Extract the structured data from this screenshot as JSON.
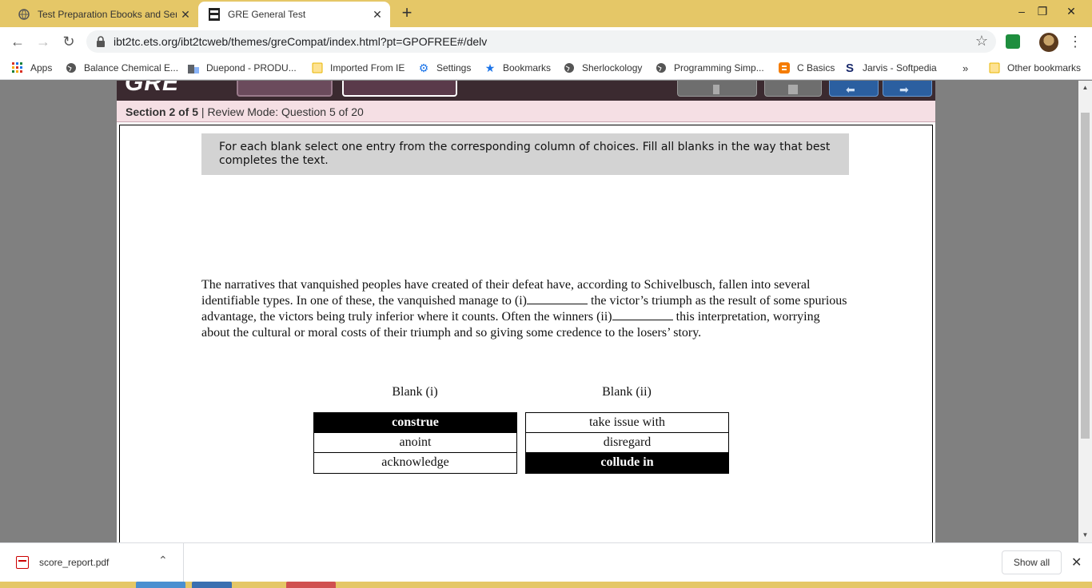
{
  "browser": {
    "tabs": [
      {
        "title": "Test Preparation Ebooks and Ser",
        "active": false
      },
      {
        "title": "GRE General Test",
        "active": true
      }
    ],
    "url": "ibt2tc.ets.org/ibt2tcweb/themes/greCompat/index.html?pt=GPOFREE#/delv",
    "bookmarks": [
      {
        "label": "Apps",
        "icon": "apps-grid-icon"
      },
      {
        "label": "Balance Chemical E...",
        "icon": "globe-icon"
      },
      {
        "label": "Duepond - PRODU...",
        "icon": "building-icon"
      },
      {
        "label": "Imported From IE",
        "icon": "folder-icon"
      },
      {
        "label": "Settings",
        "icon": "gear-icon"
      },
      {
        "label": "Bookmarks",
        "icon": "star-icon"
      },
      {
        "label": "Sherlockology",
        "icon": "globe-icon"
      },
      {
        "label": "Programming Simp...",
        "icon": "globe-icon"
      },
      {
        "label": "C Basics",
        "icon": "blogger-icon"
      },
      {
        "label": "Jarvis - Softpedia",
        "icon": "softpedia-icon"
      }
    ],
    "bookmarks_overflow": "»",
    "other_bookmarks": "Other bookmarks"
  },
  "gre": {
    "logo": "GRE",
    "section": {
      "label": "Section 2 of 5",
      "mode": "| Review Mode: Question 5 of 20"
    },
    "instructions": "For each blank select one entry from the corresponding column of choices. Fill all blanks in the way that best completes the text.",
    "passage": {
      "part1": "The narratives that vanquished peoples have created of their defeat have, according to Schivelbusch, fallen into several identifiable types. In one of these, the vanquished manage to (i)",
      "part2": " the victor’s triumph as the result of some spurious advantage, the victors being truly inferior where it counts. Often the winners (ii)",
      "part3": " this interpretation, worrying about the cultural or moral costs of their triumph and so giving some credence to the losers’ story."
    },
    "blank1": {
      "header": "Blank (i)",
      "choices": [
        "construe",
        "anoint",
        "acknowledge"
      ],
      "selected": "construe"
    },
    "blank2": {
      "header": "Blank (ii)",
      "choices": [
        "take issue with",
        "disregard",
        "collude in"
      ],
      "selected": "collude in"
    }
  },
  "downloads": {
    "file": "score_report.pdf",
    "show_all": "Show all"
  },
  "colors": {
    "tabstrip": "#e5c767",
    "gre_header": "#3b2a30",
    "section_bar": "#f5dfe4",
    "selected_choice": "#000000"
  }
}
